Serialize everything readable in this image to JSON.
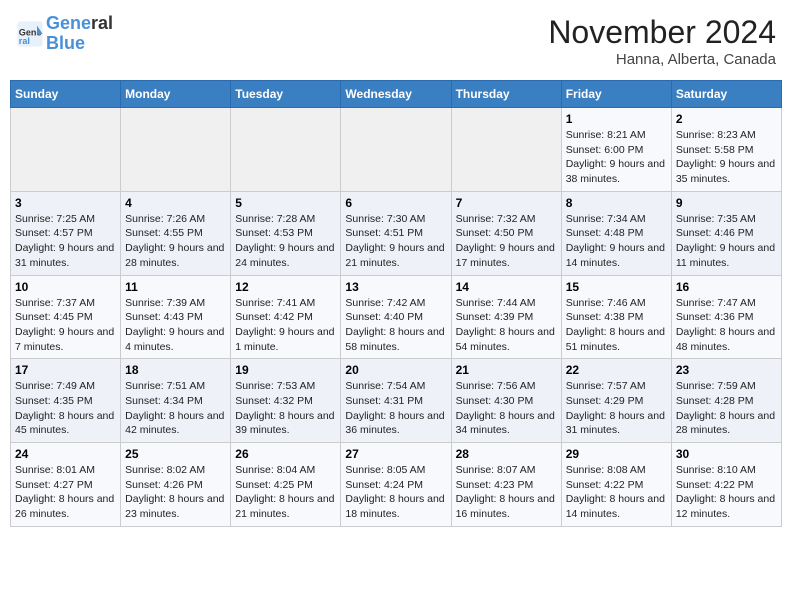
{
  "header": {
    "logo_line1": "General",
    "logo_line2": "Blue",
    "month": "November 2024",
    "location": "Hanna, Alberta, Canada"
  },
  "weekdays": [
    "Sunday",
    "Monday",
    "Tuesday",
    "Wednesday",
    "Thursday",
    "Friday",
    "Saturday"
  ],
  "weeks": [
    [
      {
        "day": "",
        "info": ""
      },
      {
        "day": "",
        "info": ""
      },
      {
        "day": "",
        "info": ""
      },
      {
        "day": "",
        "info": ""
      },
      {
        "day": "",
        "info": ""
      },
      {
        "day": "1",
        "info": "Sunrise: 8:21 AM\nSunset: 6:00 PM\nDaylight: 9 hours and 38 minutes."
      },
      {
        "day": "2",
        "info": "Sunrise: 8:23 AM\nSunset: 5:58 PM\nDaylight: 9 hours and 35 minutes."
      }
    ],
    [
      {
        "day": "3",
        "info": "Sunrise: 7:25 AM\nSunset: 4:57 PM\nDaylight: 9 hours and 31 minutes."
      },
      {
        "day": "4",
        "info": "Sunrise: 7:26 AM\nSunset: 4:55 PM\nDaylight: 9 hours and 28 minutes."
      },
      {
        "day": "5",
        "info": "Sunrise: 7:28 AM\nSunset: 4:53 PM\nDaylight: 9 hours and 24 minutes."
      },
      {
        "day": "6",
        "info": "Sunrise: 7:30 AM\nSunset: 4:51 PM\nDaylight: 9 hours and 21 minutes."
      },
      {
        "day": "7",
        "info": "Sunrise: 7:32 AM\nSunset: 4:50 PM\nDaylight: 9 hours and 17 minutes."
      },
      {
        "day": "8",
        "info": "Sunrise: 7:34 AM\nSunset: 4:48 PM\nDaylight: 9 hours and 14 minutes."
      },
      {
        "day": "9",
        "info": "Sunrise: 7:35 AM\nSunset: 4:46 PM\nDaylight: 9 hours and 11 minutes."
      }
    ],
    [
      {
        "day": "10",
        "info": "Sunrise: 7:37 AM\nSunset: 4:45 PM\nDaylight: 9 hours and 7 minutes."
      },
      {
        "day": "11",
        "info": "Sunrise: 7:39 AM\nSunset: 4:43 PM\nDaylight: 9 hours and 4 minutes."
      },
      {
        "day": "12",
        "info": "Sunrise: 7:41 AM\nSunset: 4:42 PM\nDaylight: 9 hours and 1 minute."
      },
      {
        "day": "13",
        "info": "Sunrise: 7:42 AM\nSunset: 4:40 PM\nDaylight: 8 hours and 58 minutes."
      },
      {
        "day": "14",
        "info": "Sunrise: 7:44 AM\nSunset: 4:39 PM\nDaylight: 8 hours and 54 minutes."
      },
      {
        "day": "15",
        "info": "Sunrise: 7:46 AM\nSunset: 4:38 PM\nDaylight: 8 hours and 51 minutes."
      },
      {
        "day": "16",
        "info": "Sunrise: 7:47 AM\nSunset: 4:36 PM\nDaylight: 8 hours and 48 minutes."
      }
    ],
    [
      {
        "day": "17",
        "info": "Sunrise: 7:49 AM\nSunset: 4:35 PM\nDaylight: 8 hours and 45 minutes."
      },
      {
        "day": "18",
        "info": "Sunrise: 7:51 AM\nSunset: 4:34 PM\nDaylight: 8 hours and 42 minutes."
      },
      {
        "day": "19",
        "info": "Sunrise: 7:53 AM\nSunset: 4:32 PM\nDaylight: 8 hours and 39 minutes."
      },
      {
        "day": "20",
        "info": "Sunrise: 7:54 AM\nSunset: 4:31 PM\nDaylight: 8 hours and 36 minutes."
      },
      {
        "day": "21",
        "info": "Sunrise: 7:56 AM\nSunset: 4:30 PM\nDaylight: 8 hours and 34 minutes."
      },
      {
        "day": "22",
        "info": "Sunrise: 7:57 AM\nSunset: 4:29 PM\nDaylight: 8 hours and 31 minutes."
      },
      {
        "day": "23",
        "info": "Sunrise: 7:59 AM\nSunset: 4:28 PM\nDaylight: 8 hours and 28 minutes."
      }
    ],
    [
      {
        "day": "24",
        "info": "Sunrise: 8:01 AM\nSunset: 4:27 PM\nDaylight: 8 hours and 26 minutes."
      },
      {
        "day": "25",
        "info": "Sunrise: 8:02 AM\nSunset: 4:26 PM\nDaylight: 8 hours and 23 minutes."
      },
      {
        "day": "26",
        "info": "Sunrise: 8:04 AM\nSunset: 4:25 PM\nDaylight: 8 hours and 21 minutes."
      },
      {
        "day": "27",
        "info": "Sunrise: 8:05 AM\nSunset: 4:24 PM\nDaylight: 8 hours and 18 minutes."
      },
      {
        "day": "28",
        "info": "Sunrise: 8:07 AM\nSunset: 4:23 PM\nDaylight: 8 hours and 16 minutes."
      },
      {
        "day": "29",
        "info": "Sunrise: 8:08 AM\nSunset: 4:22 PM\nDaylight: 8 hours and 14 minutes."
      },
      {
        "day": "30",
        "info": "Sunrise: 8:10 AM\nSunset: 4:22 PM\nDaylight: 8 hours and 12 minutes."
      }
    ]
  ]
}
